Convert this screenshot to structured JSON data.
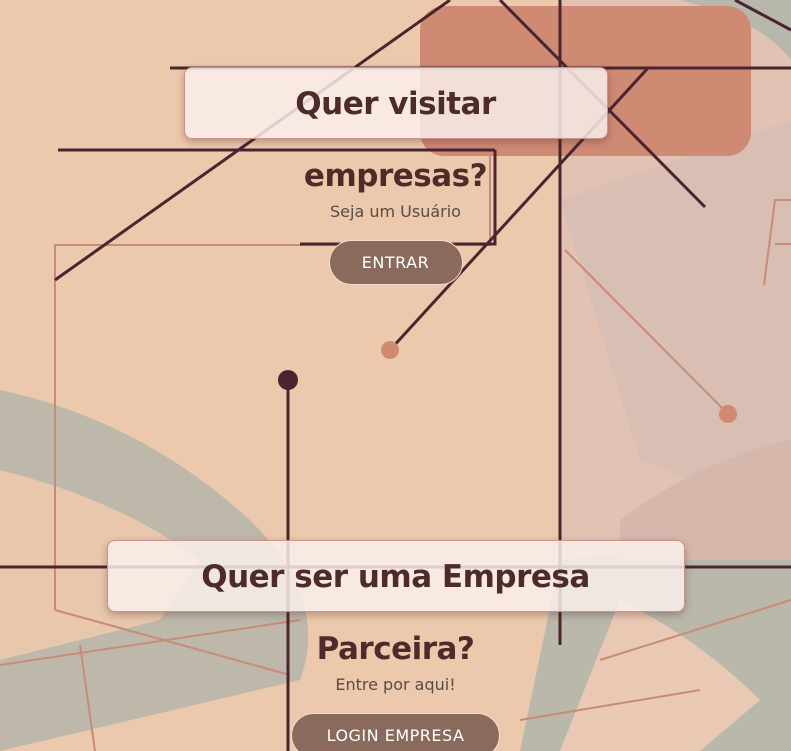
{
  "user_section": {
    "title": "Quer visitar empresas?",
    "subtitle": "Seja um Usuário",
    "button_label": "ENTRAR"
  },
  "partner_section": {
    "title": "Quer ser uma Empresa Parceira?",
    "subtitle": "Entre por aqui!",
    "button_label": "LOGIN EMPRESA"
  },
  "colors": {
    "background": "#ecc9ac",
    "accent_block": "#cf8a74",
    "sage_shape": "#b8b8aa",
    "line_dark": "#4a2530",
    "line_light": "#c98a78",
    "heading_text": "#4e2b2b",
    "button_fill": "#8a6a5c",
    "button_text": "#ffffff"
  }
}
